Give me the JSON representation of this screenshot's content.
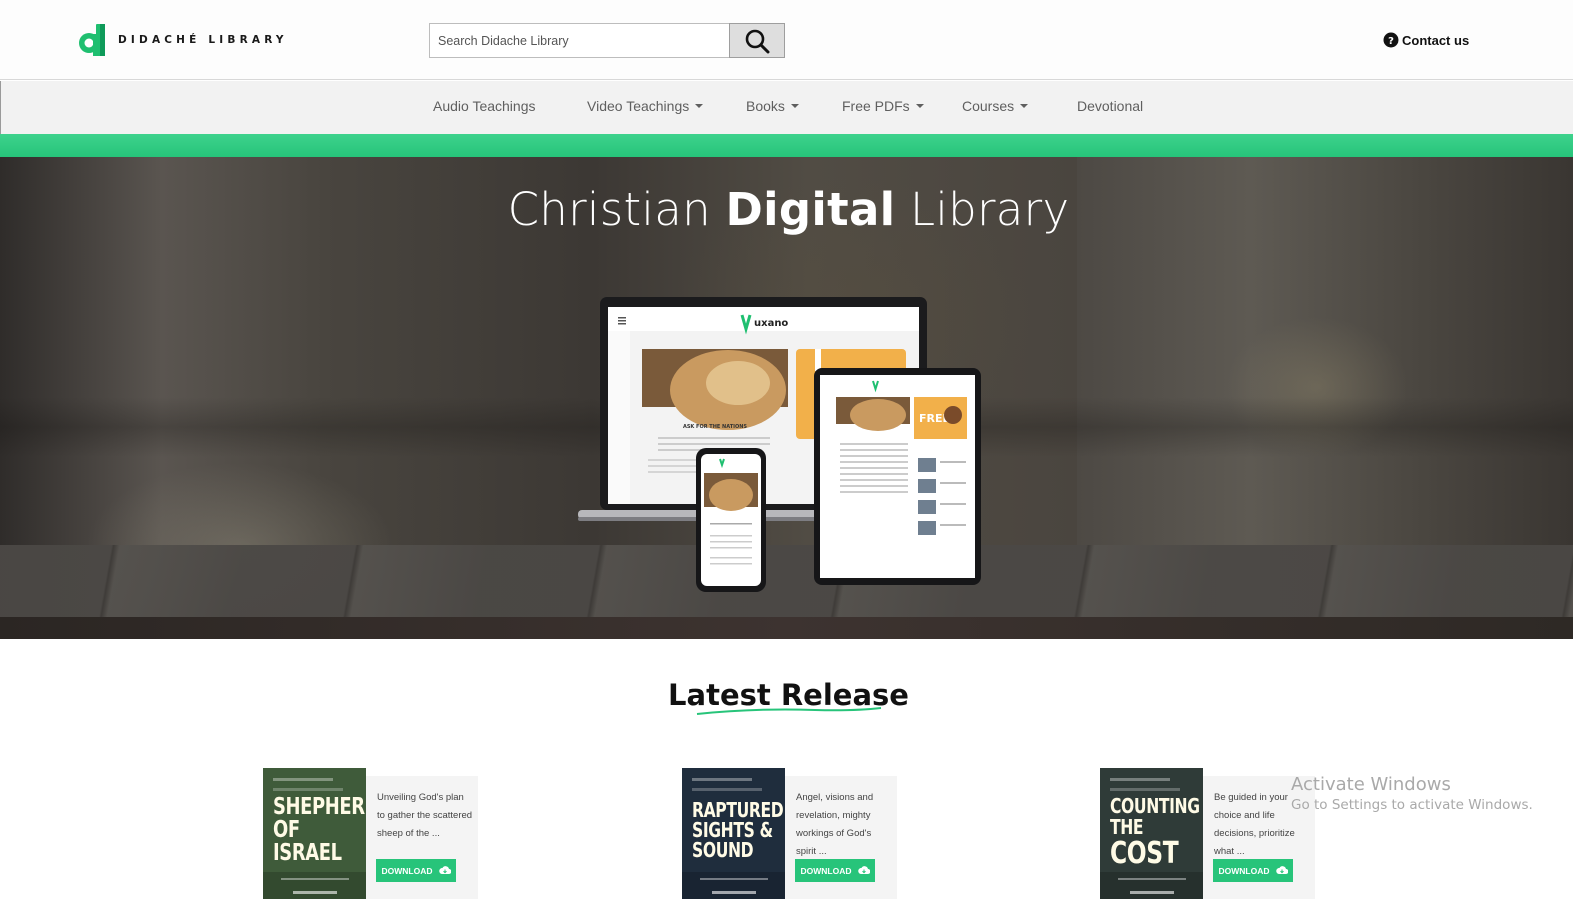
{
  "header": {
    "logo_text": "DIDACHÉ LIBRARY",
    "search_placeholder": "Search Didache Library",
    "contact_label": "Contact us"
  },
  "nav": {
    "items": [
      {
        "label": "Audio Teachings",
        "dropdown": false
      },
      {
        "label": "Video Teachings",
        "dropdown": true
      },
      {
        "label": "Books",
        "dropdown": true
      },
      {
        "label": "Free PDFs",
        "dropdown": true
      },
      {
        "label": "Courses",
        "dropdown": true
      },
      {
        "label": "Devotional",
        "dropdown": false
      }
    ]
  },
  "hero": {
    "title_pre": "Christian ",
    "title_bold": "Digital",
    "title_post": " Library",
    "device_brand": "uxano",
    "device_article": "ASK FOR THE NATIONS",
    "device_promo": "FREE"
  },
  "latest": {
    "title": "Latest Release",
    "books": [
      {
        "cover": [
          "SHEPHERD",
          "OF",
          "ISRAEL"
        ],
        "desc": "Unveiling God's plan to gather the scattered sheep of the ...",
        "download": "DOWNLOAD",
        "cover_color": "#3f5b3a"
      },
      {
        "cover": [
          "RAPTURED:",
          "SIGHTS &",
          "SOUND"
        ],
        "desc": "Angel, visions and revelation, mighty workings of God's spirit ...",
        "download": "DOWNLOAD",
        "cover_color": "#1f2d3d"
      },
      {
        "cover": [
          "COUNTING",
          "THE",
          "COST"
        ],
        "desc": "Be guided in your choice and life decisions, prioritize what ...",
        "download": "DOWNLOAD",
        "cover_color": "#2f3b38"
      }
    ]
  },
  "watermark": {
    "line1": "Activate Windows",
    "line2": "Go to Settings to activate Windows."
  },
  "colors": {
    "accent": "#27c47a",
    "logo_green": "#1fbf70"
  }
}
